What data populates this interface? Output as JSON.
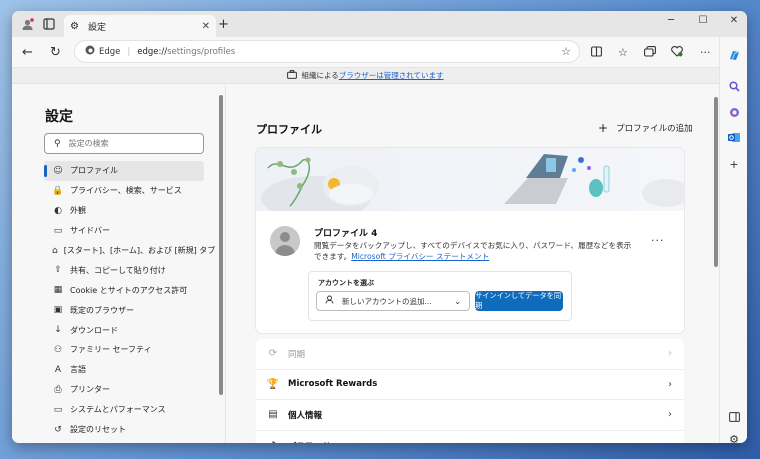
{
  "window": {
    "tab_title": "設定",
    "new_tab": "+",
    "controls": {
      "minimize": "─",
      "maximize": "☐",
      "close": "✕"
    }
  },
  "toolbar": {
    "site_label": "Edge",
    "url_host": "edge://",
    "url_path": "settings/profiles"
  },
  "infobar": {
    "prefix": "組織による",
    "link": "ブラウザーは管理されています"
  },
  "sidebar": {
    "title": "設定",
    "search_placeholder": "設定の検索",
    "items": [
      {
        "label": "プロファイル",
        "icon": "profile-icon",
        "glyph": "☺"
      },
      {
        "label": "プライバシー、検索、サービス",
        "icon": "lock-icon",
        "glyph": "🔒"
      },
      {
        "label": "外観",
        "icon": "palette-icon",
        "glyph": "◐"
      },
      {
        "label": "サイドバー",
        "icon": "sidebar-icon",
        "glyph": "▭"
      },
      {
        "label": "[スタート]、[ホーム]、および [新規] タブ",
        "icon": "home-icon",
        "glyph": "⌂"
      },
      {
        "label": "共有、コピーして貼り付け",
        "icon": "share-icon",
        "glyph": "⇪"
      },
      {
        "label": "Cookie とサイトのアクセス許可",
        "icon": "cookie-icon",
        "glyph": "▦"
      },
      {
        "label": "既定のブラウザー",
        "icon": "browser-icon",
        "glyph": "▣"
      },
      {
        "label": "ダウンロード",
        "icon": "download-icon",
        "glyph": "↓"
      },
      {
        "label": "ファミリー セーフティ",
        "icon": "family-icon",
        "glyph": "⚇"
      },
      {
        "label": "言語",
        "icon": "language-icon",
        "glyph": "A"
      },
      {
        "label": "プリンター",
        "icon": "printer-icon",
        "glyph": "⎙"
      },
      {
        "label": "システムとパフォーマンス",
        "icon": "system-icon",
        "glyph": "▭"
      },
      {
        "label": "設定のリセット",
        "icon": "reset-icon",
        "glyph": "↺"
      }
    ]
  },
  "main": {
    "title": "プロファイル",
    "add_profile": "プロファイルの追加",
    "profile": {
      "name": "プロファイル 4",
      "description": "閲覧データをバックアップし、すべてのデバイスでお気に入り、パスワード、履歴などを表示できます。",
      "privacy_link": "Microsoft プライバシー ステートメント",
      "more": "···"
    },
    "account": {
      "label": "アカウントを選ぶ",
      "selected": "新しいアカウントの追加...",
      "sync_button": "サインインしてデータを同期"
    },
    "rows": [
      {
        "label": "同期",
        "icon": "sync-icon",
        "glyph": "⟳",
        "disabled": true
      },
      {
        "label": "Microsoft Rewards",
        "icon": "rewards-icon",
        "glyph": "🏆",
        "disabled": false
      },
      {
        "label": "個人情報",
        "icon": "personal-info-icon",
        "glyph": "▤",
        "disabled": false
      },
      {
        "label": "パスワード",
        "icon": "key-icon",
        "glyph": "⚷",
        "disabled": false
      }
    ]
  },
  "colors": {
    "accent": "#0f6cbd",
    "link": "#1a63c8"
  }
}
